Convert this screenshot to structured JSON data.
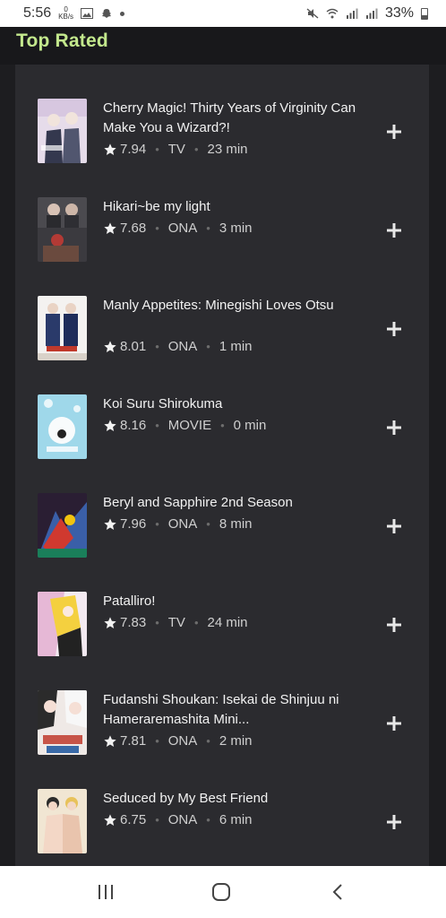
{
  "status": {
    "time": "5:56",
    "kbs_value": "0",
    "kbs_unit": "KB/s",
    "battery": "33%"
  },
  "header": {
    "title": "Top Rated"
  },
  "items": [
    {
      "title": "Cherry Magic! Thirty Years of Virginity Can Make You a Wizard?!",
      "rating": "7.94",
      "type": "TV",
      "duration": "23 min"
    },
    {
      "title": "Hikari~be my light",
      "rating": "7.68",
      "type": "ONA",
      "duration": "3 min"
    },
    {
      "title": "Manly Appetites: Minegishi Loves Otsu",
      "rating": "8.01",
      "type": "ONA",
      "duration": "1 min"
    },
    {
      "title": "Koi Suru Shirokuma",
      "rating": "8.16",
      "type": "MOVIE",
      "duration": "0 min"
    },
    {
      "title": "Beryl and Sapphire 2nd Season",
      "rating": "7.96",
      "type": "ONA",
      "duration": "8 min"
    },
    {
      "title": "Patalliro!",
      "rating": "7.83",
      "type": "TV",
      "duration": "24 min"
    },
    {
      "title": "Fudanshi Shoukan: Isekai de Shinjuu ni Hameraremashita Mini...",
      "rating": "7.81",
      "type": "ONA",
      "duration": "2 min"
    },
    {
      "title": "Seduced by My Best Friend",
      "rating": "6.75",
      "type": "ONA",
      "duration": "6 min"
    }
  ],
  "icons": {
    "star": "star-icon",
    "add": "plus-icon",
    "nav_recent": "recent-apps-icon",
    "nav_home": "home-icon",
    "nav_back": "back-icon"
  },
  "colors": {
    "accent": "#c3e88d",
    "panel": "#2b2b2f",
    "background": "#1d1d20"
  }
}
